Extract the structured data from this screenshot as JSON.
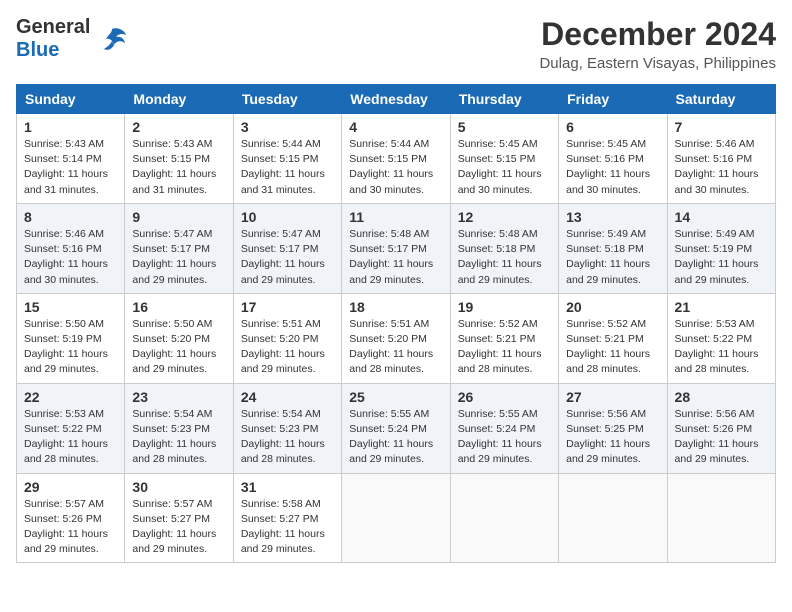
{
  "logo": {
    "general": "General",
    "blue": "Blue"
  },
  "title": {
    "month": "December 2024",
    "location": "Dulag, Eastern Visayas, Philippines"
  },
  "headers": [
    "Sunday",
    "Monday",
    "Tuesday",
    "Wednesday",
    "Thursday",
    "Friday",
    "Saturday"
  ],
  "weeks": [
    [
      {
        "day": "1",
        "info": "Sunrise: 5:43 AM\nSunset: 5:14 PM\nDaylight: 11 hours\nand 31 minutes."
      },
      {
        "day": "2",
        "info": "Sunrise: 5:43 AM\nSunset: 5:15 PM\nDaylight: 11 hours\nand 31 minutes."
      },
      {
        "day": "3",
        "info": "Sunrise: 5:44 AM\nSunset: 5:15 PM\nDaylight: 11 hours\nand 31 minutes."
      },
      {
        "day": "4",
        "info": "Sunrise: 5:44 AM\nSunset: 5:15 PM\nDaylight: 11 hours\nand 30 minutes."
      },
      {
        "day": "5",
        "info": "Sunrise: 5:45 AM\nSunset: 5:15 PM\nDaylight: 11 hours\nand 30 minutes."
      },
      {
        "day": "6",
        "info": "Sunrise: 5:45 AM\nSunset: 5:16 PM\nDaylight: 11 hours\nand 30 minutes."
      },
      {
        "day": "7",
        "info": "Sunrise: 5:46 AM\nSunset: 5:16 PM\nDaylight: 11 hours\nand 30 minutes."
      }
    ],
    [
      {
        "day": "8",
        "info": "Sunrise: 5:46 AM\nSunset: 5:16 PM\nDaylight: 11 hours\nand 30 minutes."
      },
      {
        "day": "9",
        "info": "Sunrise: 5:47 AM\nSunset: 5:17 PM\nDaylight: 11 hours\nand 29 minutes."
      },
      {
        "day": "10",
        "info": "Sunrise: 5:47 AM\nSunset: 5:17 PM\nDaylight: 11 hours\nand 29 minutes."
      },
      {
        "day": "11",
        "info": "Sunrise: 5:48 AM\nSunset: 5:17 PM\nDaylight: 11 hours\nand 29 minutes."
      },
      {
        "day": "12",
        "info": "Sunrise: 5:48 AM\nSunset: 5:18 PM\nDaylight: 11 hours\nand 29 minutes."
      },
      {
        "day": "13",
        "info": "Sunrise: 5:49 AM\nSunset: 5:18 PM\nDaylight: 11 hours\nand 29 minutes."
      },
      {
        "day": "14",
        "info": "Sunrise: 5:49 AM\nSunset: 5:19 PM\nDaylight: 11 hours\nand 29 minutes."
      }
    ],
    [
      {
        "day": "15",
        "info": "Sunrise: 5:50 AM\nSunset: 5:19 PM\nDaylight: 11 hours\nand 29 minutes."
      },
      {
        "day": "16",
        "info": "Sunrise: 5:50 AM\nSunset: 5:20 PM\nDaylight: 11 hours\nand 29 minutes."
      },
      {
        "day": "17",
        "info": "Sunrise: 5:51 AM\nSunset: 5:20 PM\nDaylight: 11 hours\nand 29 minutes."
      },
      {
        "day": "18",
        "info": "Sunrise: 5:51 AM\nSunset: 5:20 PM\nDaylight: 11 hours\nand 28 minutes."
      },
      {
        "day": "19",
        "info": "Sunrise: 5:52 AM\nSunset: 5:21 PM\nDaylight: 11 hours\nand 28 minutes."
      },
      {
        "day": "20",
        "info": "Sunrise: 5:52 AM\nSunset: 5:21 PM\nDaylight: 11 hours\nand 28 minutes."
      },
      {
        "day": "21",
        "info": "Sunrise: 5:53 AM\nSunset: 5:22 PM\nDaylight: 11 hours\nand 28 minutes."
      }
    ],
    [
      {
        "day": "22",
        "info": "Sunrise: 5:53 AM\nSunset: 5:22 PM\nDaylight: 11 hours\nand 28 minutes."
      },
      {
        "day": "23",
        "info": "Sunrise: 5:54 AM\nSunset: 5:23 PM\nDaylight: 11 hours\nand 28 minutes."
      },
      {
        "day": "24",
        "info": "Sunrise: 5:54 AM\nSunset: 5:23 PM\nDaylight: 11 hours\nand 28 minutes."
      },
      {
        "day": "25",
        "info": "Sunrise: 5:55 AM\nSunset: 5:24 PM\nDaylight: 11 hours\nand 29 minutes."
      },
      {
        "day": "26",
        "info": "Sunrise: 5:55 AM\nSunset: 5:24 PM\nDaylight: 11 hours\nand 29 minutes."
      },
      {
        "day": "27",
        "info": "Sunrise: 5:56 AM\nSunset: 5:25 PM\nDaylight: 11 hours\nand 29 minutes."
      },
      {
        "day": "28",
        "info": "Sunrise: 5:56 AM\nSunset: 5:26 PM\nDaylight: 11 hours\nand 29 minutes."
      }
    ],
    [
      {
        "day": "29",
        "info": "Sunrise: 5:57 AM\nSunset: 5:26 PM\nDaylight: 11 hours\nand 29 minutes."
      },
      {
        "day": "30",
        "info": "Sunrise: 5:57 AM\nSunset: 5:27 PM\nDaylight: 11 hours\nand 29 minutes."
      },
      {
        "day": "31",
        "info": "Sunrise: 5:58 AM\nSunset: 5:27 PM\nDaylight: 11 hours\nand 29 minutes."
      },
      null,
      null,
      null,
      null
    ]
  ]
}
